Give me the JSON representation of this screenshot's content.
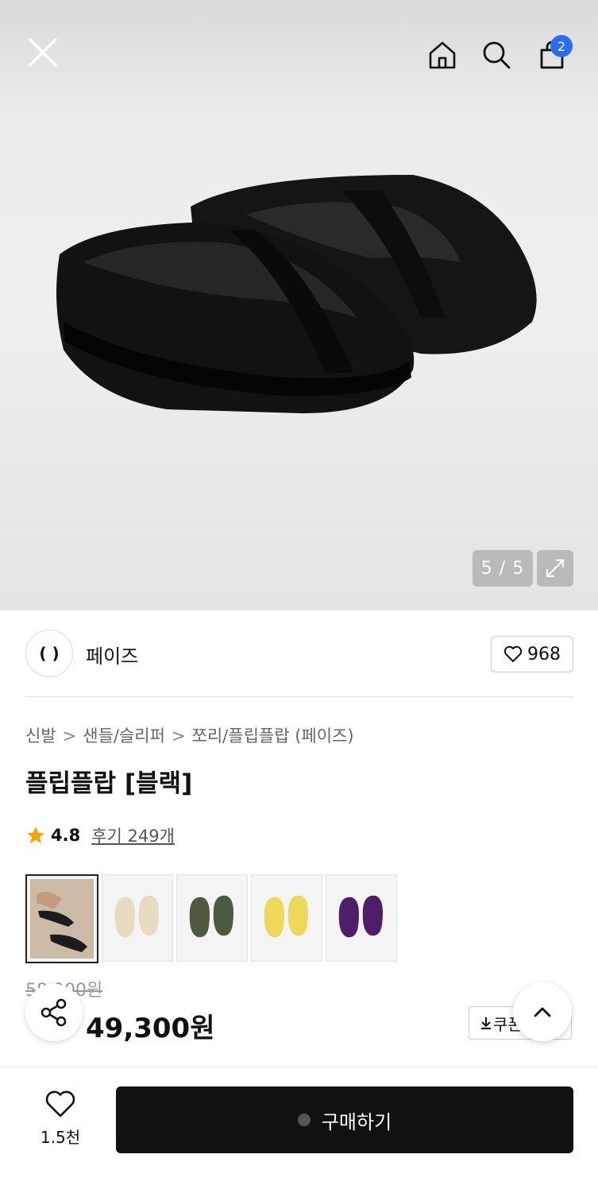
{
  "gallery": {
    "counter": "5 / 5",
    "cart_count": "2"
  },
  "brand": {
    "logo_text": "( )",
    "name": "페이즈",
    "likes": "968"
  },
  "breadcrumb": [
    "신발",
    "샌들/슬리퍼",
    "쪼리/플립플랍 (페이즈)"
  ],
  "product": {
    "title": "플립플랍 [블랙]",
    "rating": "4.8",
    "reviews": "후기 249개",
    "original_price": "58,000원",
    "price": "49,300원",
    "coupon_label": "쿠폰"
  },
  "swatches": [
    {
      "name": "black",
      "color": "#1c1c1c",
      "selected": true
    },
    {
      "name": "beige",
      "color": "#e7dcc2"
    },
    {
      "name": "khaki",
      "color": "#4e5a40"
    },
    {
      "name": "yellow",
      "color": "#eed85a"
    },
    {
      "name": "purple",
      "color": "#4f1e6b"
    }
  ],
  "bottom": {
    "fav_count": "1.5천",
    "buy_label": "구매하기"
  }
}
